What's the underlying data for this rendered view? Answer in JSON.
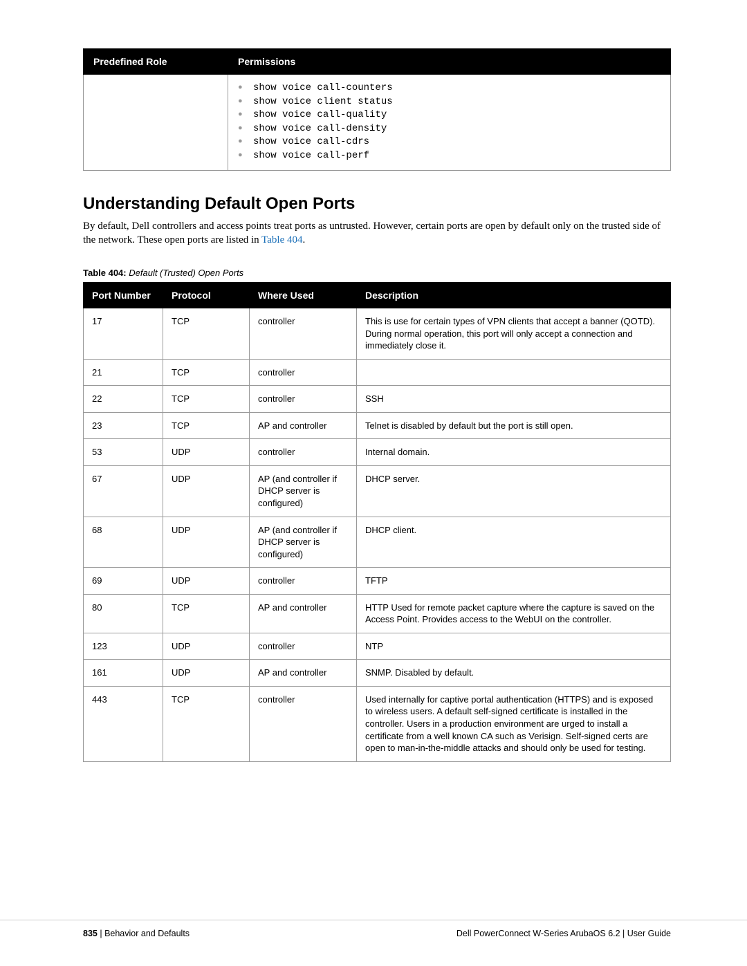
{
  "role_table": {
    "headers": {
      "role": "Predefined Role",
      "permissions": "Permissions"
    },
    "commands": [
      "show voice call-counters",
      "show voice client status",
      "show voice call-quality",
      "show voice call-density",
      "show voice call-cdrs",
      "show voice call-perf"
    ]
  },
  "section": {
    "title": "Understanding Default Open Ports",
    "body_pre": "By default, Dell controllers and access points treat ports as untrusted. However, certain ports are open by default only on the trusted side of the network. These open ports are listed in ",
    "link_text": "Table 404",
    "body_post": "."
  },
  "table_caption": {
    "label": "Table 404:",
    "title": "Default (Trusted) Open Ports"
  },
  "port_table": {
    "headers": {
      "port": "Port Number",
      "protocol": "Protocol",
      "where": "Where Used",
      "desc": "Description"
    },
    "rows": [
      {
        "port": "17",
        "protocol": "TCP",
        "where": "controller",
        "desc": "This is use for certain types of VPN clients that accept a banner (QOTD). During normal operation, this port will only accept a connection and immediately close it."
      },
      {
        "port": "21",
        "protocol": "TCP",
        "where": "controller",
        "desc": ""
      },
      {
        "port": "22",
        "protocol": "TCP",
        "where": "controller",
        "desc": "SSH"
      },
      {
        "port": "23",
        "protocol": "TCP",
        "where": "AP and controller",
        "desc": "Telnet is disabled by default but the port is still open."
      },
      {
        "port": "53",
        "protocol": "UDP",
        "where": "controller",
        "desc": "Internal domain."
      },
      {
        "port": "67",
        "protocol": "UDP",
        "where": "AP (and controller if DHCP server is configured)",
        "desc": "DHCP server."
      },
      {
        "port": "68",
        "protocol": "UDP",
        "where": "AP (and controller if DHCP server is configured)",
        "desc": "DHCP client."
      },
      {
        "port": "69",
        "protocol": "UDP",
        "where": "controller",
        "desc": "TFTP"
      },
      {
        "port": "80",
        "protocol": "TCP",
        "where": "AP and controller",
        "desc": "HTTP Used for remote packet capture where the capture is saved on the Access Point. Provides access to the WebUI on the controller."
      },
      {
        "port": "123",
        "protocol": "UDP",
        "where": "controller",
        "desc": "NTP"
      },
      {
        "port": "161",
        "protocol": "UDP",
        "where": "AP and controller",
        "desc": "SNMP. Disabled by default."
      },
      {
        "port": "443",
        "protocol": "TCP",
        "where": "controller",
        "desc": "Used internally for captive portal authentication (HTTPS) and is exposed to wireless users. A default self-signed certificate is installed in the controller. Users in a production environment are urged to install a certificate from a well known CA such as Verisign. Self-signed certs are open to man-in-the-middle attacks and should only be used for testing."
      }
    ]
  },
  "footer": {
    "page_num": "835",
    "left_sep": " | ",
    "left_text": "Behavior and Defaults",
    "right_text": "Dell PowerConnect W-Series ArubaOS 6.2  |  User Guide"
  }
}
